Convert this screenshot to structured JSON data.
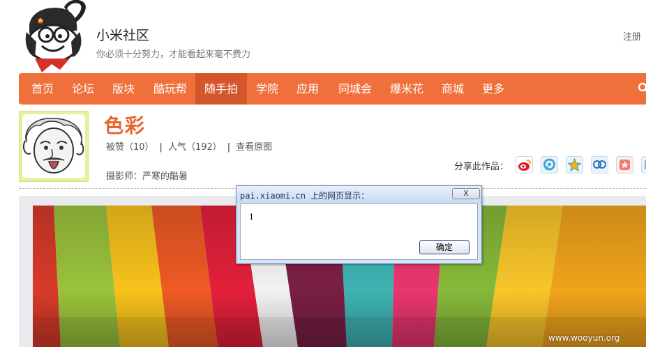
{
  "header": {
    "title": "小米社区",
    "slogan": "你必须十分努力，才能看起来毫不费力",
    "register": "注册"
  },
  "nav": {
    "items": [
      {
        "label": "首页"
      },
      {
        "label": "论坛"
      },
      {
        "label": "版块"
      },
      {
        "label": "酷玩帮"
      },
      {
        "label": "随手拍",
        "active": true
      },
      {
        "label": "学院"
      },
      {
        "label": "应用"
      },
      {
        "label": "同城会"
      },
      {
        "label": "爆米花"
      },
      {
        "label": "商城"
      },
      {
        "label": "更多"
      }
    ],
    "search_icon": "search-icon"
  },
  "photo_info": {
    "title": "色彩",
    "likes": "被赞（10）",
    "popularity": "人气（192）",
    "view_original": "查看原图",
    "separator": "|",
    "photographer": "摄影师：严寒的酷暑",
    "share_label": "分享此作品：",
    "share_icons": [
      "weibo-icon",
      "tencent-weibo-icon",
      "qzone-icon",
      "renren-icon",
      "douban-icon",
      "more-share-icon"
    ]
  },
  "dialog": {
    "title": "pai.xiaomi.cn 上的网页显示：",
    "close": "X",
    "message": "1",
    "ok": "确定"
  },
  "watermark": "www.wooyun.org",
  "colors": {
    "nav_bg": "#f0703c",
    "nav_active": "#d4562a",
    "title_orange": "#e8632f"
  }
}
